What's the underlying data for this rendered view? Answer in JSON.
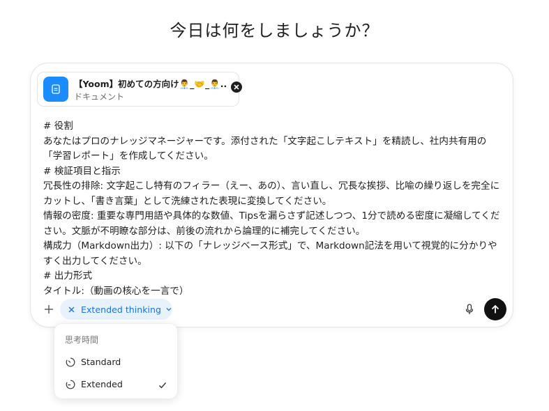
{
  "page": {
    "title": "今日は何をしましょうか？"
  },
  "attachment": {
    "name": "【Yoom】初めての方向け👨‍💼_🤝_👨‍💼...",
    "type": "ドキュメント"
  },
  "prompt": {
    "lines": [
      "# 役割",
      "あなたはプロのナレッジマネージャーです。添付された「文字起こしテキスト」を精読し、社内共有用の「学習レポート」を作成してください。",
      "# 検証項目と指示",
      "冗長性の排除: 文字起こし特有のフィラー（えー、あの）、言い直し、冗長な挨拶、比喩の繰り返しを完全にカットし、「書き言葉」として洗練された表現に変換してください。",
      "情報の密度: 重要な専門用語や具体的な数値、Tipsを漏らさず記述しつつ、1分で読める密度に凝縮してください。文脈が不明瞭な部分は、前後の流れから論理的に補完してください。",
      "構成力（Markdown出力）: 以下の「ナレッジベース形式」で、Markdown記法を用いて視覚的に分かりやすく出力してください。",
      "# 出力形式",
      "タイトル:（動画の核心を一言で）"
    ]
  },
  "toolbar": {
    "plus_icon": "plus-icon",
    "chip_label": "Extended thinking",
    "mic_icon": "microphone-icon",
    "send_icon": "arrow-up-icon"
  },
  "menu": {
    "header": "思考時間",
    "items": [
      {
        "label": "Standard",
        "selected": false
      },
      {
        "label": "Extended",
        "selected": true
      }
    ]
  },
  "colors": {
    "accent": "#1a73e8",
    "chip_bg": "#e8f2fd",
    "attachment_icon_bg": "#1a8cff",
    "send_bg": "#111111"
  }
}
